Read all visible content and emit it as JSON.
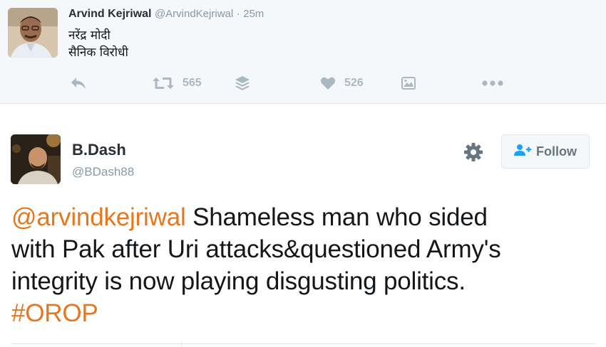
{
  "parent_tweet": {
    "author_name": "Arvind Kejriwal",
    "author_handle": "@ArvindKejriwal",
    "separator": "·",
    "timestamp": "25m",
    "text_lines": [
      "नरेंद्र मोदी",
      "सैनिक विरोधी"
    ],
    "actions": {
      "reply_icon": "reply-icon",
      "retweet_icon": "retweet-icon",
      "retweet_count": "565",
      "buffer_icon": "layers-icon",
      "like_icon": "heart-icon",
      "like_count": "526",
      "media_icon": "image-icon",
      "more_icon": "more-dots-icon"
    }
  },
  "main_tweet": {
    "author_name": "B.Dash",
    "author_handle": "@BDash88",
    "settings_icon": "gear-icon",
    "follow_label": "Follow",
    "text": {
      "mention": "@arvindkejriwal",
      "line1_rest": " Shameless man who sided",
      "line2": "with Pak after Uri attacks&questioned Army's",
      "line3": "integrity is now playing disgusting politics.",
      "hashtag": "#OROP"
    }
  },
  "colors": {
    "link": "#e8761d",
    "muted": "#8899a6",
    "action_icon": "#aab8c2",
    "parent_background": "#f5f8fa"
  }
}
